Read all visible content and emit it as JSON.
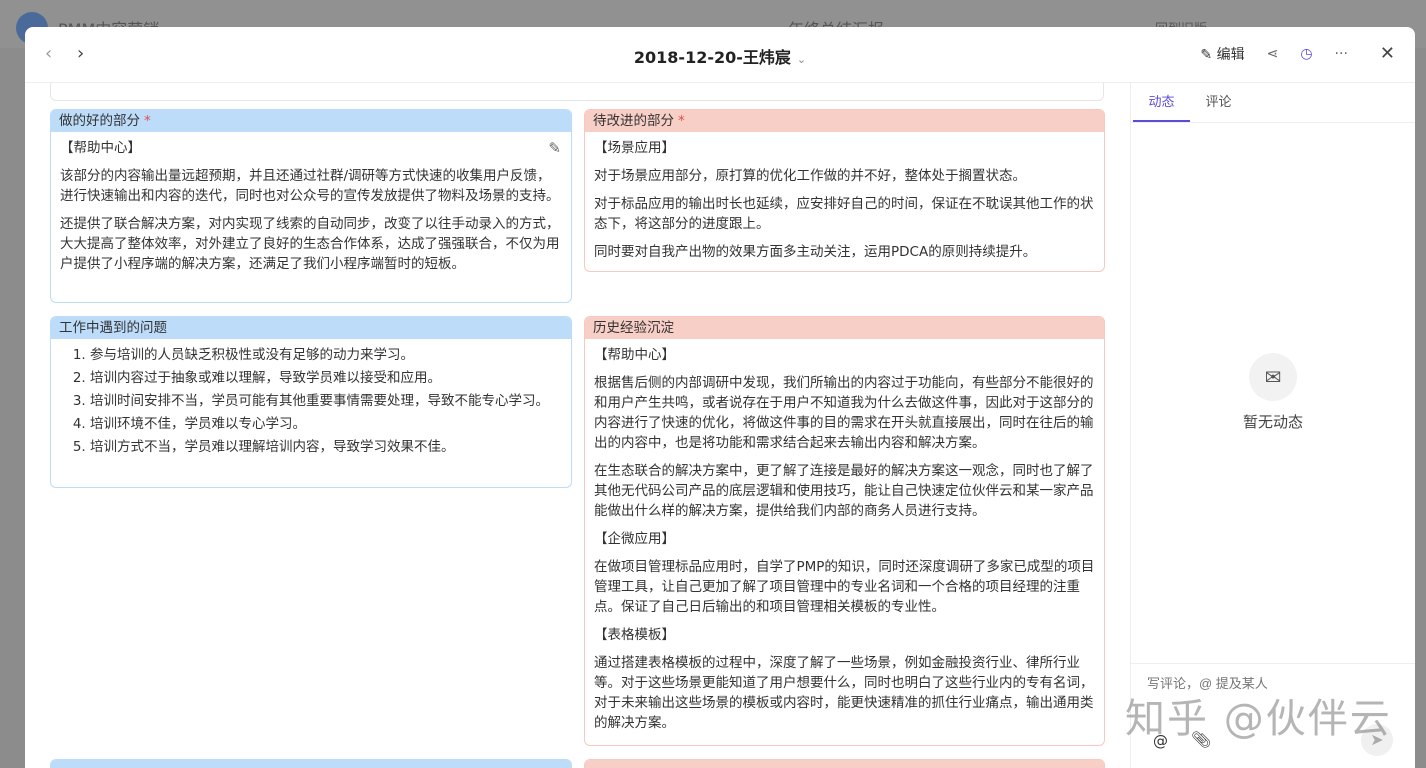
{
  "background": {
    "app_name": "PMM内容营销",
    "page_title": "年终总结汇报",
    "back_label": "回到旧版"
  },
  "header": {
    "title": "2018-12-20-王炜宸",
    "edit_label": "编辑"
  },
  "cards": {
    "good": {
      "title": "做的好的部分",
      "section": "【帮助中心】",
      "paras": [
        "该部分的内容输出量远超预期，并且还通过社群/调研等方式快速的收集用户反馈，进行快速输出和内容的迭代，同时也对公众号的宣传发放提供了物料及场景的支持。",
        "还提供了联合解决方案，对内实现了线索的自动同步，改变了以往手动录入的方式，大大提高了整体效率，对外建立了良好的生态合作体系，达成了强强联合，不仅为用户提供了小程序端的解决方案，还满足了我们小程序端暂时的短板。"
      ]
    },
    "improve": {
      "title": "待改进的部分",
      "section": "【场景应用】",
      "paras": [
        "对于场景应用部分，原打算的优化工作做的并不好，整体处于搁置状态。",
        "对于标品应用的输出时长也延续，应安排好自己的时间，保证在不耽误其他工作的状态下，将这部分的进度跟上。",
        "同时要对自我产出物的效果方面多主动关注，运用PDCA的原则持续提升。"
      ]
    },
    "problems": {
      "title": "工作中遇到的问题",
      "items": [
        "参与培训的人员缺乏积极性或没有足够的动力来学习。",
        "培训内容过于抽象或难以理解，导致学员难以接受和应用。",
        "培训时间安排不当，学员可能有其他重要事情需要处理，导致不能专心学习。",
        "培训环境不佳，学员难以专心学习。",
        "培训方式不当，学员难以理解培训内容，导致学习效果不佳。"
      ]
    },
    "history": {
      "title": "历史经验沉淀",
      "s1": "【帮助中心】",
      "p1": "根据售后侧的内部调研中发现，我们所输出的内容过于功能向，有些部分不能很好的和用户产生共鸣，或者说存在于用户不知道我为什么去做这件事，因此对于这部分的内容进行了快速的优化，将做这件事的目的需求在开头就直接展出，同时在往后的输出的内容中，也是将功能和需求结合起来去输出内容和解决方案。",
      "p2": "在生态联合的解决方案中，更了解了连接是最好的解决方案这一观念，同时也了解了其他无代码公司产品的底层逻辑和使用技巧，能让自己快速定位伙伴云和某一家产品能做出什么样的解决方案，提供给我们内部的商务人员进行支持。",
      "s2": "【企微应用】",
      "p3": "在做项目管理标品应用时，自学了PMP的知识，同时还深度调研了多家已成型的项目管理工具，让自己更加了解了项目管理中的专业名词和一个合格的项目经理的注重点。保证了自己日后输出的和项目管理相关模板的专业性。",
      "s3": "【表格模板】",
      "p4": "通过搭建表格模板的过程中，深度了解了一些场景，例如金融投资行业、律所行业等。对于这些场景更能知道了用户想要什么，同时也明白了这些行业内的专有名词，对于未来输出这些场景的模板或内容时，能更快速精准的抓住行业痛点，输出通用类的解决方案。"
    }
  },
  "sidebar": {
    "tabs": [
      "动态",
      "评论"
    ],
    "empty_text": "暂无动态",
    "comment_placeholder": "写评论，@ 提及某人"
  },
  "watermark": "知乎 @伙伴云",
  "colors": {
    "accent": "#5b4bd6",
    "blue_header": "#bcdcfa",
    "red_header": "#f7cfc6"
  }
}
